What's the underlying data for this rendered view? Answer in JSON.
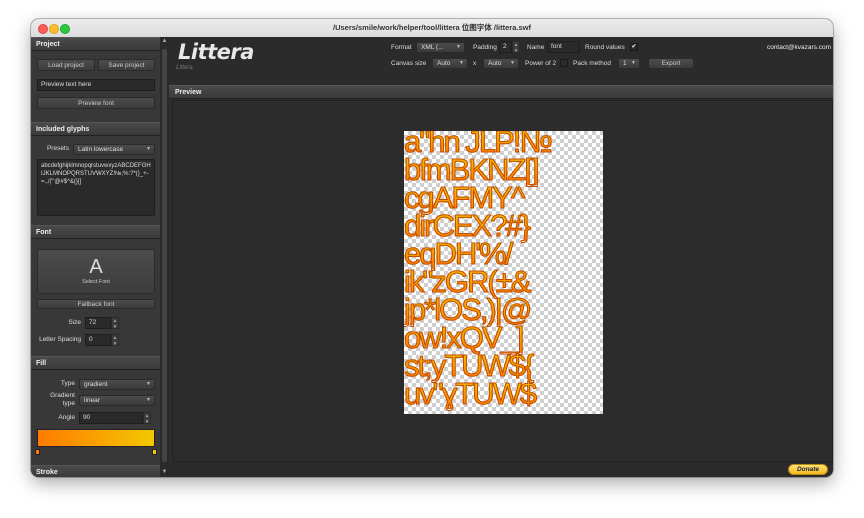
{
  "window": {
    "title": "/Users/smile/work/helper/tool/littera 位图字体 /littera.swf"
  },
  "project": {
    "header": "Project",
    "load_label": "Load project",
    "save_label": "Save project",
    "preview_text": "Preview text here",
    "preview_font_label": "Preview font"
  },
  "glyphs": {
    "header": "Included glyphs",
    "presets_label": "Presets",
    "preset_value": "Latin lowercase",
    "glyph_text": "abcdefghijklmnopqrstuvwxyzABCDEFGHIJKLMNOPQRSTUVWXYZ!№;%:?*()_+-=.,/|\"'@#$^&{}[]"
  },
  "font": {
    "header": "Font",
    "select_glyph": "A",
    "select_label": "Select Font",
    "fallback_label": "Fallback font",
    "size_label": "Size",
    "size_value": "72",
    "spacing_label": "Letter Spacing",
    "spacing_value": "0"
  },
  "fill": {
    "header": "Fill",
    "type_label": "Type",
    "type_value": "gradient",
    "gradient_type_label": "Gradient type",
    "gradient_type_value": "linear",
    "angle_label": "Angle",
    "angle_value": "90",
    "gradient_start": "#ff7b00",
    "gradient_end": "#f3c800"
  },
  "stroke": {
    "header": "Stroke"
  },
  "toolbar": {
    "logo": "Littera",
    "logo_version": "Littera",
    "format_label": "Format",
    "format_value": "XML (...",
    "padding_label": "Padding",
    "padding_value": "2",
    "name_label": "Name",
    "name_value": "font",
    "round_label": "Round values",
    "round_checked": "✔",
    "canvas_label": "Canvas size",
    "canvas_w": "Auto",
    "canvas_x": "x",
    "canvas_h": "Auto",
    "pow2_label": "Power of 2",
    "pack_label": "Pack method",
    "pack_value": "1",
    "export_label": "Export",
    "contact": "contact@kvazars.com"
  },
  "preview": {
    "header": "Preview",
    "rows": [
      "a\"hn JLP!№",
      "bfmBKNZ[]",
      "cgAFMY^",
      "dirCEX?#}",
      "eqDH'%/",
      "ik\"zGR(±&",
      "jp*lOS,)|@",
      "ow!xQV_]",
      "st;yTUW${",
      "uv\"ɣTUW$"
    ]
  },
  "donate_label": "Donate"
}
